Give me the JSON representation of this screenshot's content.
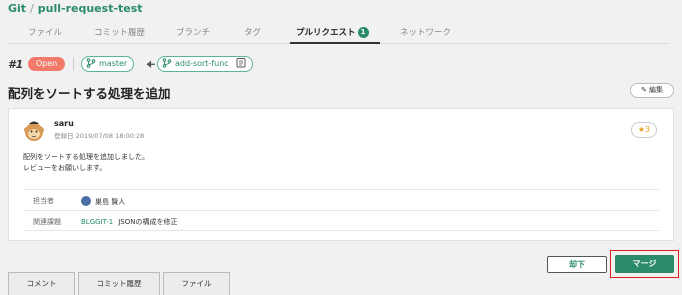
{
  "breadcrumb": {
    "root": "Git",
    "separator": "/",
    "repo": "pull-request-test"
  },
  "tabs": [
    {
      "label": "ファイル"
    },
    {
      "label": "コミット履歴"
    },
    {
      "label": "ブランチ"
    },
    {
      "label": "タグ"
    },
    {
      "label": "プルリクエスト",
      "badge": "1"
    },
    {
      "label": "ネットワーク"
    }
  ],
  "pr": {
    "number": "#1",
    "status": "Open",
    "target_branch": "master",
    "source_branch": "add-sort-func",
    "title": "配列をソートする処理を追加",
    "edit_label": "編集"
  },
  "comment": {
    "author": "saru",
    "registered": "登録日 2019/07/08 18:00:28",
    "star_count": "3",
    "body": [
      "配列をソートする処理を追加しました。",
      "レビューをお願いします。"
    ],
    "assignee_label": "担当者",
    "assignee": "巣島 賢人",
    "related_label": "関連課題",
    "related_issue_key": "BLGGIT-1",
    "related_issue_title": "JSONの構成を修正"
  },
  "actions": {
    "reject": "却下",
    "merge": "マージ"
  },
  "bottom_tabs": [
    {
      "label": "コメント"
    },
    {
      "label": "コミット履歴"
    },
    {
      "label": "ファイル"
    }
  ],
  "colors": {
    "accent": "#2a8a6a",
    "status_open": "#f17a6a",
    "highlight": "#e02020",
    "star": "#e8a020"
  }
}
